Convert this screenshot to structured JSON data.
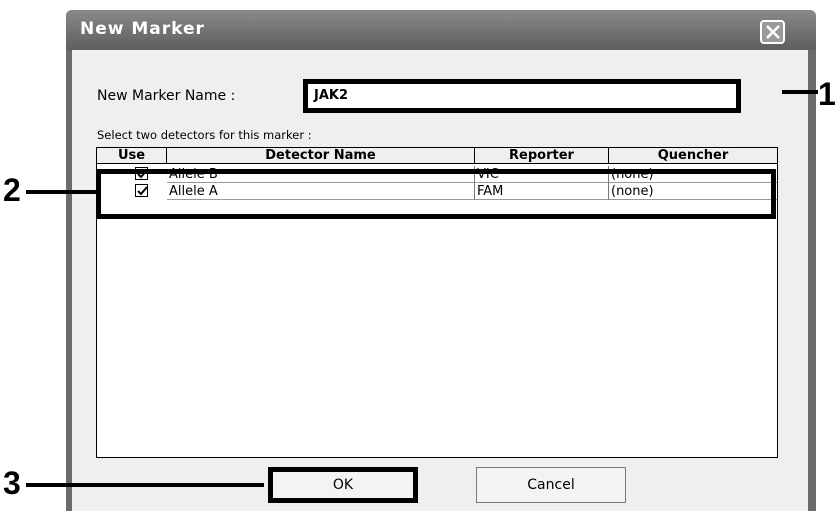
{
  "dialog": {
    "title": "New Marker",
    "name_label": "New Marker Name :",
    "name_value": "JAK2",
    "select_label": "Select two detectors for this marker :",
    "columns": [
      "Use",
      "Detector Name",
      "Reporter",
      "Quencher"
    ],
    "rows": [
      {
        "use": true,
        "detector": "Allele B",
        "reporter": "VIC",
        "quencher": "(none)"
      },
      {
        "use": true,
        "detector": "Allele A",
        "reporter": "FAM",
        "quencher": "(none)"
      }
    ],
    "ok_label": "OK",
    "cancel_label": "Cancel"
  },
  "annotations": {
    "label1": "1",
    "label2": "2",
    "label3": "3"
  }
}
